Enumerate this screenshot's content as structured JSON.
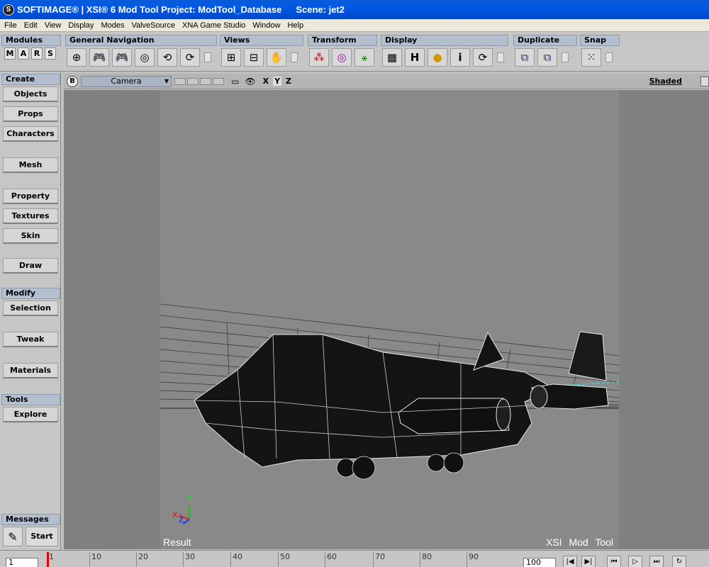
{
  "window": {
    "title": "SOFTIMAGE® | XSI® 6 Mod Tool Project: ModTool_Database",
    "scene": "Scene: jet2"
  },
  "menu": [
    "File",
    "Edit",
    "View",
    "Display",
    "Modes",
    "ValveSource",
    "XNA Game Studio",
    "Window",
    "Help"
  ],
  "toolbar": {
    "modules": {
      "label": "Modules",
      "letters": [
        "M",
        "A",
        "R",
        "S"
      ]
    },
    "general_navigation": {
      "label": "General Navigation",
      "icons": [
        "select-icon",
        "orbit-icon",
        "track-icon",
        "zoom-icon",
        "pivot-icon",
        "frame-icon"
      ]
    },
    "views": {
      "label": "Views",
      "icons": [
        "explorer-icon",
        "schematic-icon",
        "hand-icon"
      ]
    },
    "transform": {
      "label": "Transform",
      "icons": [
        "scale-icon",
        "rotate-icon",
        "translate-icon"
      ]
    },
    "display": {
      "label": "Display",
      "icons": [
        "grid-icon",
        "H",
        "light-icon",
        "info-icon",
        "refresh-icon"
      ]
    },
    "duplicate": {
      "label": "Duplicate",
      "icons": [
        "duplicate-icon",
        "clone-icon"
      ]
    },
    "snap": {
      "label": "Snap",
      "icons": [
        "snap-grid-icon"
      ]
    }
  },
  "left_panel": {
    "create": {
      "header": "Create",
      "buttons": [
        "Objects",
        "Props",
        "Characters",
        "Mesh",
        "Property",
        "Textures",
        "Skin",
        "Draw"
      ]
    },
    "modify": {
      "header": "Modify",
      "buttons": [
        "Selection",
        "Tweak",
        "Materials"
      ]
    },
    "tools": {
      "header": "Tools",
      "buttons": [
        "Explore"
      ]
    },
    "messages": {
      "header": "Messages",
      "start": "Start"
    }
  },
  "viewport": {
    "b_button": "B",
    "camera": "Camera",
    "axes": [
      "X",
      "Y",
      "Z"
    ],
    "mode": "Shaded",
    "label_result": "Result",
    "label_brand": "XSI Mod Tool",
    "gizmo_y": "Y",
    "gizmo_x": "X",
    "gizmo_z": "Z"
  },
  "timeline": {
    "current_frame": "1",
    "end_frame": "100",
    "ticks": [
      "1",
      "10",
      "20",
      "30",
      "40",
      "50",
      "60",
      "70",
      "80",
      "90"
    ],
    "controls": [
      "|◀",
      "▶|",
      "⏮",
      "▷",
      "⏭",
      "↻"
    ]
  }
}
